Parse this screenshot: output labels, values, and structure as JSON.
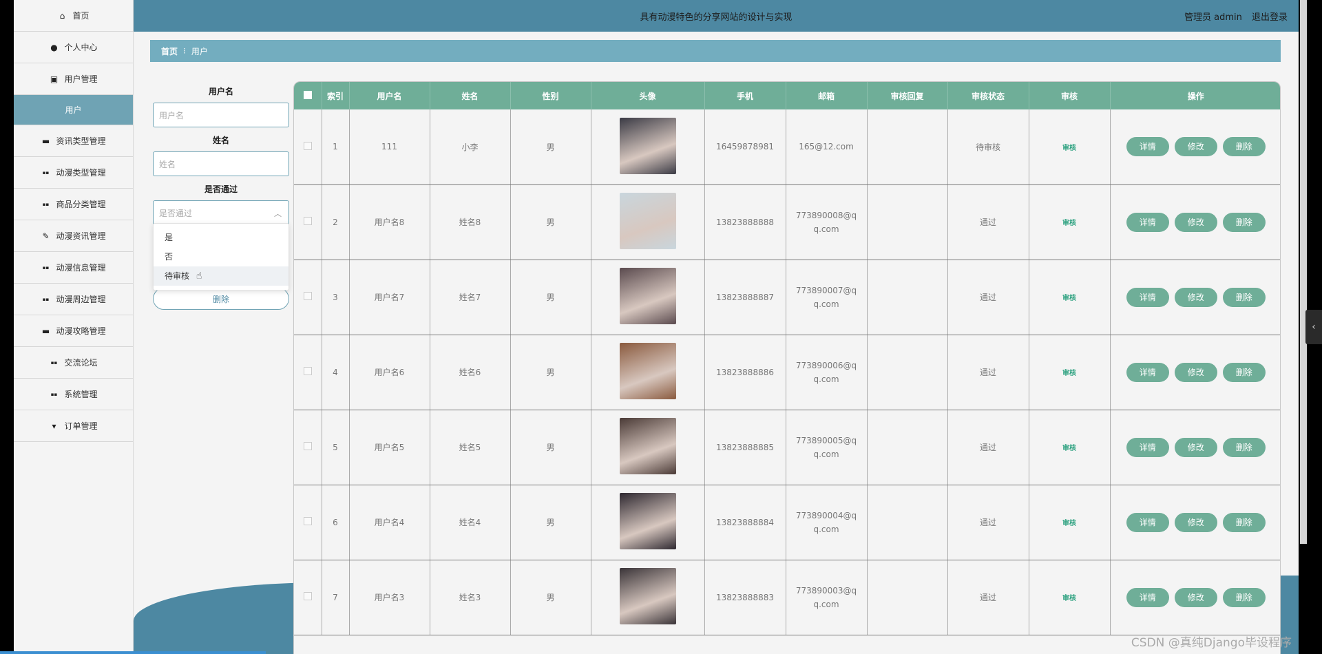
{
  "topbar": {
    "title": "具有动漫特色的分享网站的设计与实现",
    "user_label": "管理员 admin",
    "logout": "退出登录"
  },
  "sidebar": {
    "items": [
      {
        "label": "首页",
        "icon": "home-icon"
      },
      {
        "label": "个人中心",
        "icon": "person-icon"
      },
      {
        "label": "用户管理",
        "icon": "clipboard-icon"
      },
      {
        "label": "用户",
        "icon": ""
      },
      {
        "label": "资讯类型管理",
        "icon": "briefcase-icon"
      },
      {
        "label": "动漫类型管理",
        "icon": "grid-icon"
      },
      {
        "label": "商品分类管理",
        "icon": "grid-icon"
      },
      {
        "label": "动漫资讯管理",
        "icon": "pen-icon"
      },
      {
        "label": "动漫信息管理",
        "icon": "grid-icon"
      },
      {
        "label": "动漫周边管理",
        "icon": "grid-icon"
      },
      {
        "label": "动漫攻略管理",
        "icon": "monitor-icon"
      },
      {
        "label": "交流论坛",
        "icon": "grid-icon"
      },
      {
        "label": "系统管理",
        "icon": "grid-icon"
      },
      {
        "label": "订单管理",
        "icon": "register-icon"
      }
    ]
  },
  "breadcrumb": {
    "home": "首页",
    "sep": "⁝",
    "current": "用户"
  },
  "filter": {
    "username_label": "用户名",
    "username_placeholder": "用户名",
    "name_label": "姓名",
    "name_placeholder": "姓名",
    "pass_label": "是否通过",
    "pass_placeholder": "是否通过",
    "options": [
      "是",
      "否",
      "待审核"
    ],
    "delete_button": "删除"
  },
  "table": {
    "headers": [
      "索引",
      "用户名",
      "姓名",
      "性别",
      "头像",
      "手机",
      "邮箱",
      "审核回复",
      "审核状态",
      "审核",
      "操作"
    ],
    "rows": [
      {
        "index": "1",
        "username": "111",
        "name": "小李",
        "gender": "男",
        "phone": "16459878981",
        "email": "165@12.com",
        "reply": "",
        "status": "待审核",
        "audit": "审核",
        "avatar_color": "#3a3a44"
      },
      {
        "index": "2",
        "username": "用户名8",
        "name": "姓名8",
        "gender": "男",
        "phone": "13823888888",
        "email": "773890008@qq.com",
        "reply": "",
        "status": "通过",
        "audit": "审核",
        "avatar_color": "#c9d6dd"
      },
      {
        "index": "3",
        "username": "用户名7",
        "name": "姓名7",
        "gender": "男",
        "phone": "13823888887",
        "email": "773890007@qq.com",
        "reply": "",
        "status": "通过",
        "audit": "审核",
        "avatar_color": "#5a4a4e"
      },
      {
        "index": "4",
        "username": "用户名6",
        "name": "姓名6",
        "gender": "男",
        "phone": "13823888886",
        "email": "773890006@qq.com",
        "reply": "",
        "status": "通过",
        "audit": "审核",
        "avatar_color": "#8a5a3e"
      },
      {
        "index": "5",
        "username": "用户名5",
        "name": "姓名5",
        "gender": "男",
        "phone": "13823888885",
        "email": "773890005@qq.com",
        "reply": "",
        "status": "通过",
        "audit": "审核",
        "avatar_color": "#4a3a36"
      },
      {
        "index": "6",
        "username": "用户名4",
        "name": "姓名4",
        "gender": "男",
        "phone": "13823888884",
        "email": "773890004@qq.com",
        "reply": "",
        "status": "通过",
        "audit": "审核",
        "avatar_color": "#2e2830"
      },
      {
        "index": "7",
        "username": "用户名3",
        "name": "姓名3",
        "gender": "男",
        "phone": "13823888883",
        "email": "773890003@qq.com",
        "reply": "",
        "status": "通过",
        "audit": "审核",
        "avatar_color": "#3a3438"
      }
    ],
    "actions": {
      "detail": "详情",
      "edit": "修改",
      "delete": "删除"
    }
  },
  "watermark": "CSDN @真纯Django毕设程序"
}
